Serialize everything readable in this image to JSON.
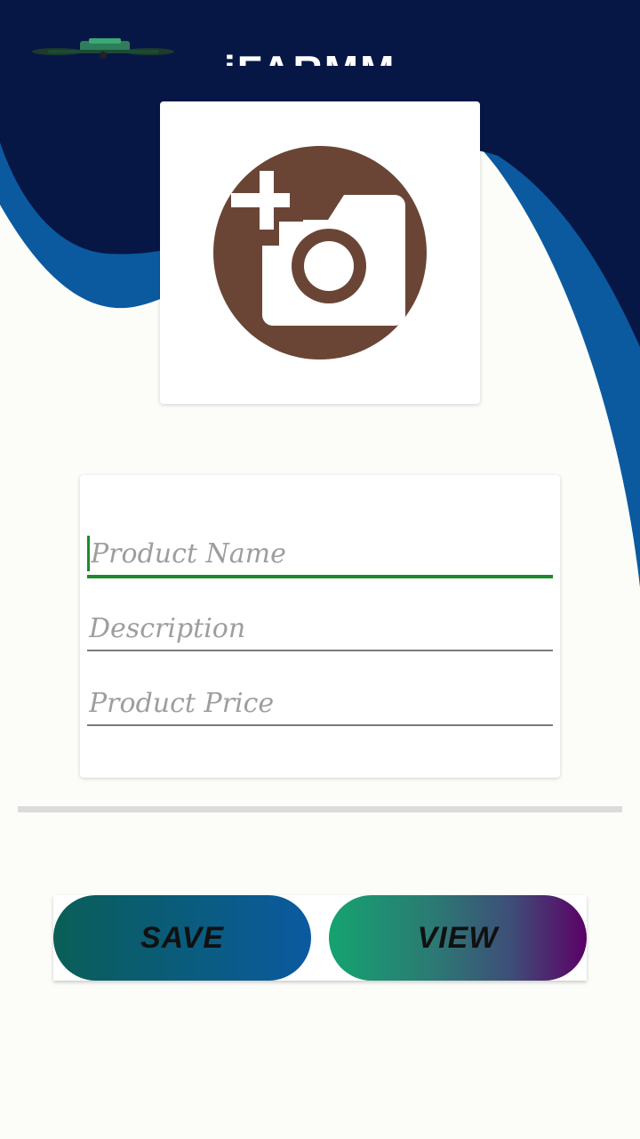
{
  "header": {
    "app_title": "iFARMM",
    "logo": "drone-logo-icon"
  },
  "image_picker": {
    "icon": "add-photo-camera-icon",
    "icon_color": "#6a4536"
  },
  "form": {
    "product_name": {
      "placeholder": "Product Name",
      "value": ""
    },
    "description": {
      "placeholder": "Description",
      "value": ""
    },
    "product_price": {
      "placeholder": "Product Price",
      "value": ""
    }
  },
  "buttons": {
    "save_label": "SAVE",
    "view_label": "VIEW"
  },
  "colors": {
    "header_navy": "#071745",
    "header_blue": "#0b5aa0",
    "focus_green": "#1b8c2a"
  }
}
